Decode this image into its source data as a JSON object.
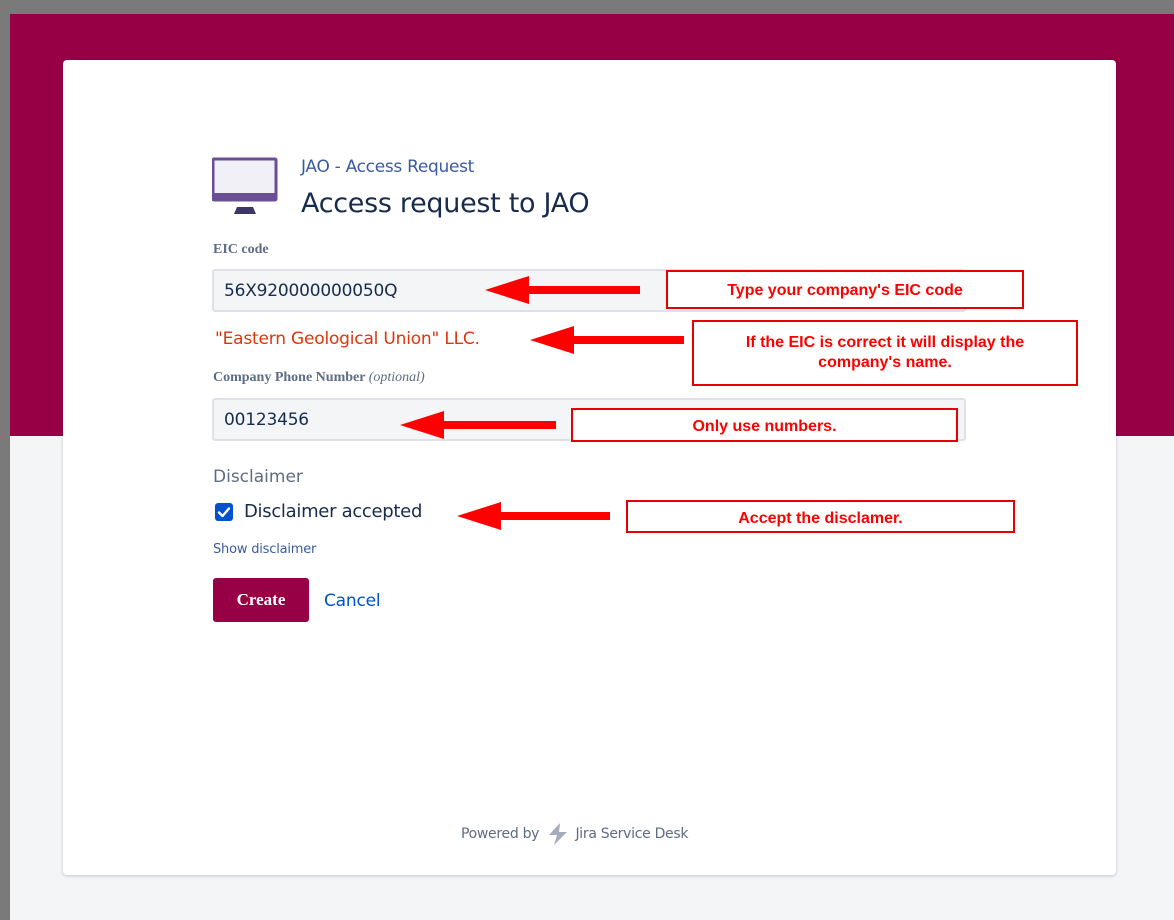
{
  "request_type": {
    "breadcrumb": "JAO - Access Request",
    "title": "Access request to JAO"
  },
  "fields": {
    "eic": {
      "label": "EIC code",
      "value": "56X920000000050Q"
    },
    "company_name": "\"Eastern Geological Union\" LLC.",
    "phone": {
      "label": "Company Phone Number",
      "optional": "(optional)",
      "value": "00123456"
    },
    "disclaimer": {
      "section": "Disclaimer",
      "checkbox_label": "Disclaimer accepted",
      "checked": true,
      "show_link": "Show disclaimer"
    }
  },
  "actions": {
    "create": "Create",
    "cancel": "Cancel"
  },
  "footer": {
    "powered_by": "Powered by",
    "product": "Jira Service Desk"
  },
  "annotations": {
    "eic": "Type your company's EIC code",
    "company_line1": "If the EIC is correct it will display the",
    "company_line2": "company's name.",
    "phone": "Only use numbers.",
    "disclaimer": "Accept the disclamer."
  },
  "colors": {
    "brand": "#970044",
    "link": "#3a5ba0",
    "error_text": "#de350b",
    "checkbox": "#0052cc",
    "annotation": "#ff0000"
  },
  "icons": {
    "request_type": "monitor-icon",
    "checkbox": "checkmark-icon",
    "footer": "jira-bolt-icon",
    "annotation": "arrow-left-icon"
  }
}
